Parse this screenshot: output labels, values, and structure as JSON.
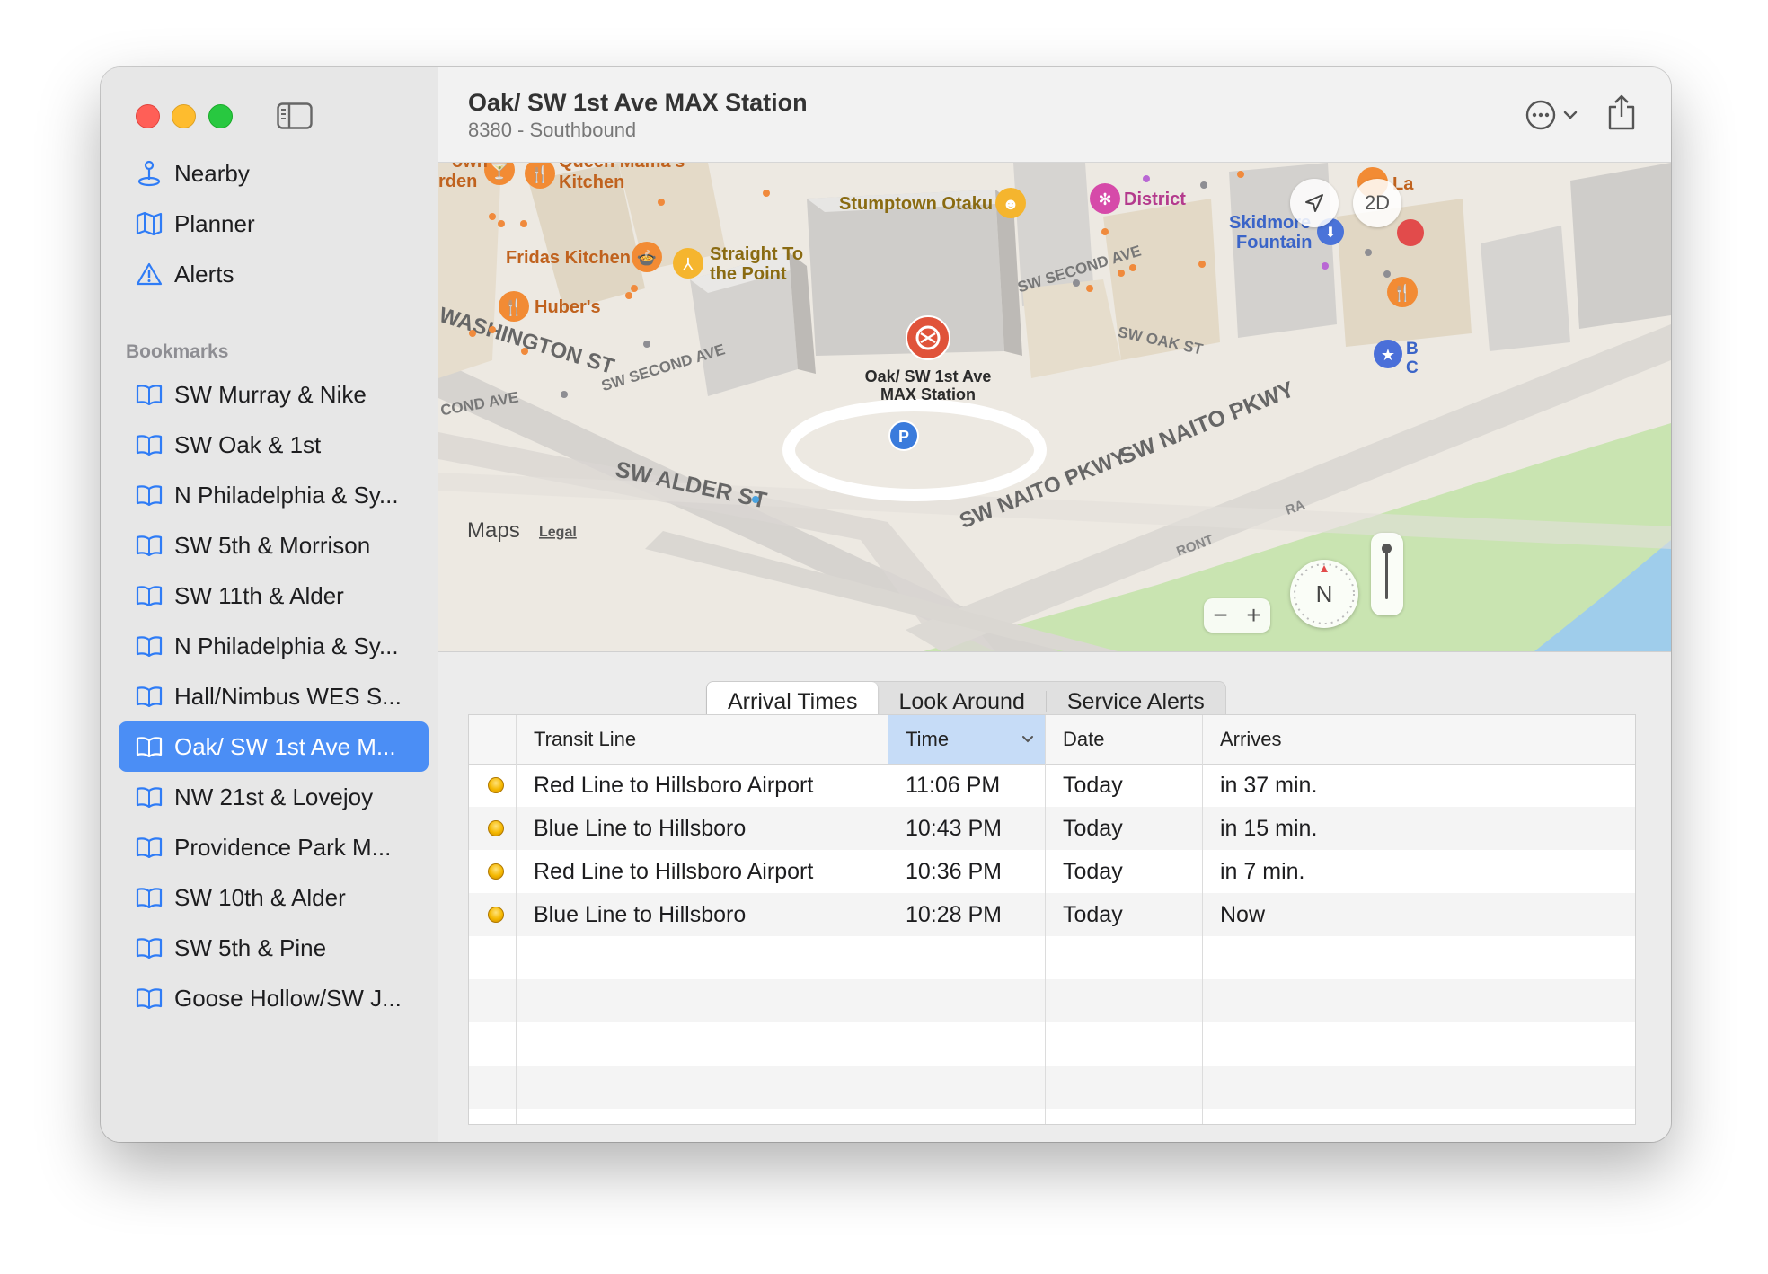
{
  "window": {
    "title": "Oak/ SW 1st Ave MAX Station",
    "subtitle": "8380 - Southbound"
  },
  "sidebar": {
    "nav": [
      {
        "label": "Nearby",
        "icon": "location-pin-icon"
      },
      {
        "label": "Planner",
        "icon": "map-icon"
      },
      {
        "label": "Alerts",
        "icon": "warning-triangle-icon"
      }
    ],
    "bookmarks_title": "Bookmarks",
    "bookmarks": [
      {
        "label": "SW Murray & Nike"
      },
      {
        "label": "SW Oak & 1st"
      },
      {
        "label": "N Philadelphia & Sy..."
      },
      {
        "label": "SW 5th & Morrison"
      },
      {
        "label": "SW 11th & Alder"
      },
      {
        "label": "N Philadelphia & Sy..."
      },
      {
        "label": "Hall/Nimbus WES S..."
      },
      {
        "label": "Oak/ SW 1st Ave M...",
        "selected": true
      },
      {
        "label": "NW 21st & Lovejoy"
      },
      {
        "label": "Providence Park M..."
      },
      {
        "label": "SW 10th & Alder"
      },
      {
        "label": "SW 5th & Pine"
      },
      {
        "label": "Goose Hollow/SW J..."
      }
    ]
  },
  "map": {
    "station_label_1": "Oak/ SW 1st Ave",
    "station_label_2": "MAX Station",
    "pois": {
      "queen_mamas_1": "Queen Mama's",
      "queen_mamas_2": "Kitchen",
      "garden_1": "own",
      "garden_2": "rden",
      "stumptown": "Stumptown Otaku",
      "district": "District",
      "fridas": "Fridas Kitchen",
      "straight_1": "Straight To",
      "straight_2": "the Point",
      "hubers": "Huber's",
      "skidmore_1": "Skidmore",
      "skidmore_2": "Fountain",
      "la": "La",
      "b_edge": "B",
      "c_edge": "C"
    },
    "streets": {
      "washington": "WASHINGTON ST",
      "second_ave_1": "SW SECOND AVE",
      "second_ave_2": "COND AVE",
      "second_ave_3": "SW SECOND AVE",
      "oak": "SW OAK ST",
      "naito_1": "SW NAITO PKWY",
      "naito_2": "SW NAITO PKWY",
      "alder": "SW ALDER ST",
      "front": "RONT",
      "ra": "RA"
    },
    "parking_label": "P",
    "attribution": "Maps",
    "legal": "Legal",
    "view_mode": "2D",
    "compass": "N",
    "zoom_out": "−",
    "zoom_in": "+"
  },
  "tabs": [
    {
      "label": "Arrival Times",
      "active": true
    },
    {
      "label": "Look Around",
      "active": false
    },
    {
      "label": "Service Alerts",
      "active": false
    }
  ],
  "table": {
    "columns": [
      "",
      "Transit Line",
      "Time",
      "Date",
      "Arrives"
    ],
    "sorted_column": "Time",
    "rows": [
      {
        "line": "Red Line to Hillsboro Airport",
        "time": "11:06 PM",
        "date": "Today",
        "arrives": "in 37 min."
      },
      {
        "line": "Blue Line to Hillsboro",
        "time": "10:43 PM",
        "date": "Today",
        "arrives": "in 15 min."
      },
      {
        "line": "Red Line to Hillsboro Airport",
        "time": "10:36 PM",
        "date": "Today",
        "arrives": "in 7 min."
      },
      {
        "line": "Blue Line to Hillsboro",
        "time": "10:28 PM",
        "date": "Today",
        "arrives": "Now"
      }
    ]
  },
  "colors": {
    "accent": "#4b8ef5",
    "status_dot": "#f5b800",
    "station_marker": "#e0533a"
  }
}
